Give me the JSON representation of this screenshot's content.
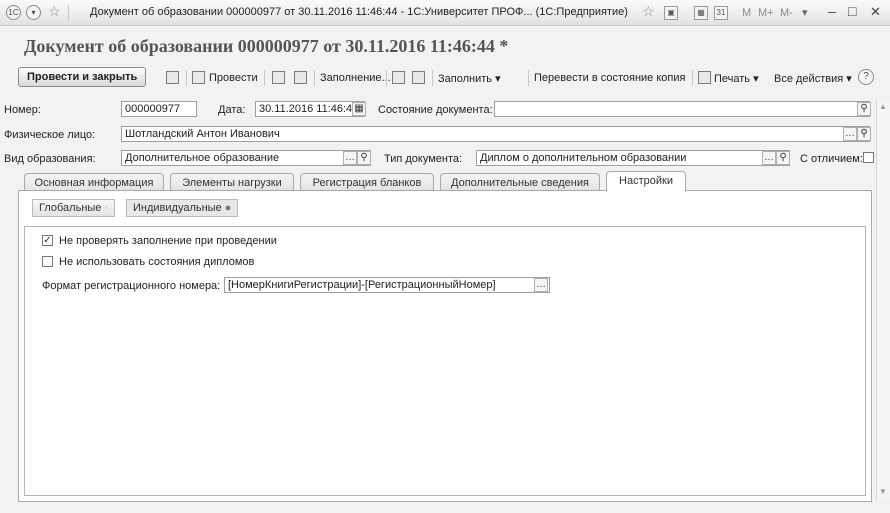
{
  "window": {
    "title": "Документ об образовании 000000977 от 30.11.2016 11:46:44 - 1С:Университет ПРОФ... (1С:Предприятие)",
    "calc_m": "M",
    "calc_mplus": "M+",
    "calc_mminus": "M-",
    "minimize": "–",
    "maximize": "□",
    "close": "✕"
  },
  "doc_title": "Документ об образовании 000000977 от 30.11.2016 11:46:44 *",
  "toolbar": {
    "post_close": "Провести и закрыть",
    "post": "Провести",
    "fill_dots": "Заполнение...",
    "fill": "Заполнить",
    "to_copy": "Перевести в состояние копия",
    "print": "Печать",
    "all_actions": "Все действия",
    "help": "?"
  },
  "form": {
    "number_label": "Номер:",
    "number_value": "000000977",
    "date_label": "Дата:",
    "date_value": "30.11.2016 11:46:44",
    "state_label": "Состояние документа:",
    "state_value": "",
    "person_label": "Физическое лицо:",
    "person_value": "Шотландский Антон Иванович",
    "edu_kind_label": "Вид образования:",
    "edu_kind_value": "Дополнительное образование",
    "doc_type_label": "Тип документа:",
    "doc_type_value": "Диплом о дополнительном образовании",
    "honors_label": "С отличием:",
    "honors_checked": false
  },
  "tabs": [
    "Основная информация",
    "Элементы нагрузки",
    "Регистрация бланков",
    "Дополнительные сведения",
    "Настройки"
  ],
  "active_tab": "Настройки",
  "subtabs": [
    "Глобальные",
    "Индивидуальные"
  ],
  "settings": {
    "no_check_label": "Не проверять заполнение при проведении",
    "no_check_checked": true,
    "no_states_label": "Не использовать состояния дипломов",
    "no_states_checked": false,
    "reg_format_label": "Формат регистрационного номера:",
    "reg_format_value": "[НомерКнигиРегистрации]-[РегистрационныйНомер]"
  }
}
